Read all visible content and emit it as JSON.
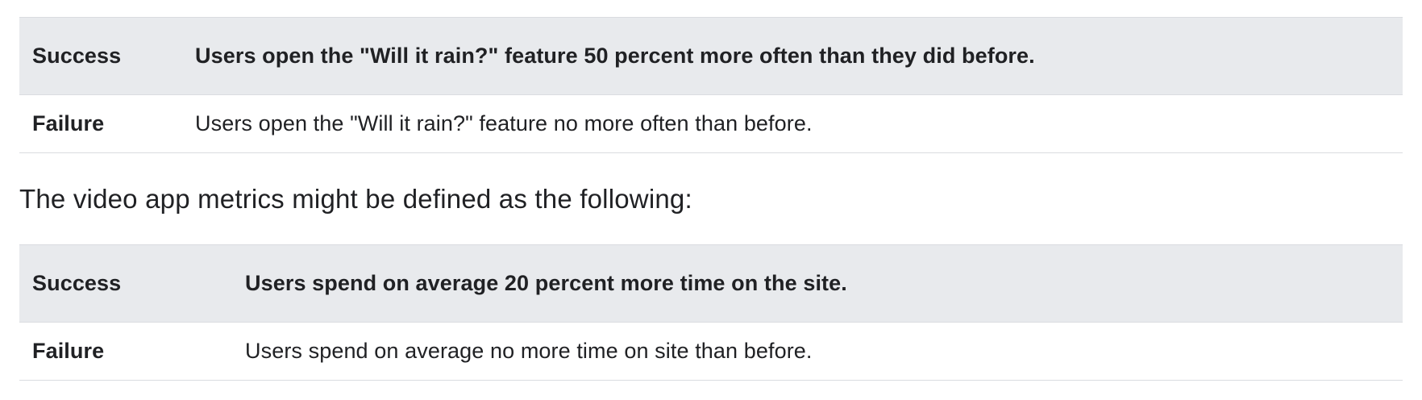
{
  "weather_table": {
    "rows": [
      {
        "label": "Success",
        "description": "Users open the \"Will it rain?\" feature 50 percent more often than they did before."
      },
      {
        "label": "Failure",
        "description": "Users open the \"Will it rain?\" feature no more often than before."
      }
    ]
  },
  "intro_text": "The video app metrics might be defined as the following:",
  "video_table": {
    "rows": [
      {
        "label": "Success",
        "description": "Users spend on average 20 percent more time on the site."
      },
      {
        "label": "Failure",
        "description": "Users spend on average no more time on site than before."
      }
    ]
  }
}
